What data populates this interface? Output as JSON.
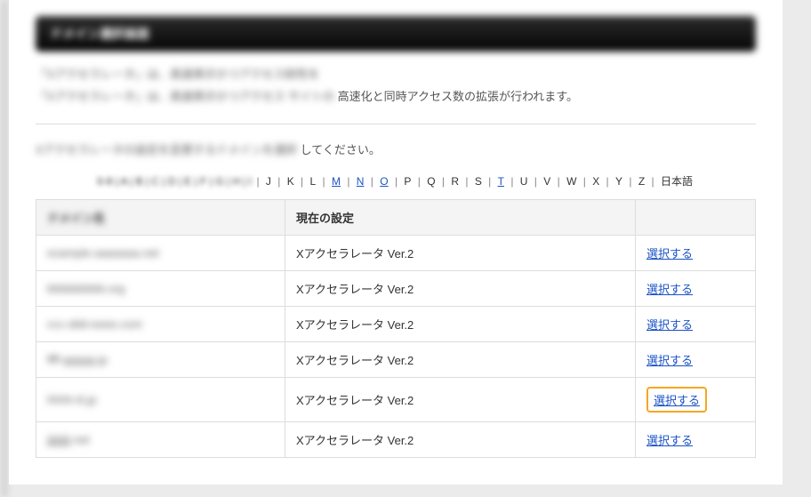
{
  "title_bar": "ドメイン選択画面",
  "desc_blur1": "「Xアクセラレータ」は、高速表示かつアクセス耐性を",
  "desc_blur2": "「Xアクセラレータ」は、高速表示かつアクセス  サイトの",
  "desc_clear": "高速化と同時アクセス数の拡張が行われます。",
  "instruction_blur": "Xアクセラレータの設定を変更するドメインを選択",
  "instruction_clear": "してください。",
  "alpha_blur_head": "0-9 | A | B | C | D | E | F | G | H | I",
  "alpha_items": [
    {
      "t": "J",
      "link": false
    },
    {
      "t": "K",
      "link": false
    },
    {
      "t": "L",
      "link": false
    },
    {
      "t": "M",
      "link": true
    },
    {
      "t": "N",
      "link": true
    },
    {
      "t": "O",
      "link": true
    },
    {
      "t": "P",
      "link": false
    },
    {
      "t": "Q",
      "link": false
    },
    {
      "t": "R",
      "link": false
    },
    {
      "t": "S",
      "link": false
    },
    {
      "t": "T",
      "link": true
    },
    {
      "t": "U",
      "link": false
    },
    {
      "t": "V",
      "link": false
    },
    {
      "t": "W",
      "link": false
    },
    {
      "t": "X",
      "link": false
    },
    {
      "t": "Y",
      "link": false
    },
    {
      "t": "Z",
      "link": false
    },
    {
      "t": "日本語",
      "link": false
    }
  ],
  "table": {
    "header_domain": "ドメイン名",
    "header_setting": "現在の設定",
    "header_action": "",
    "rows": [
      {
        "domain": "example-aaaaaaa.net",
        "setting": "Xアクセラレータ Ver.2",
        "action": "選択する",
        "hl": false
      },
      {
        "domain": "bbbbbbbbb.org",
        "setting": "Xアクセラレータ Ver.2",
        "action": "選択する",
        "hl": false
      },
      {
        "domain": "ccc-ddd-eeee.com",
        "setting": "Xアクセラレータ Ver.2",
        "action": "選択する",
        "hl": false
      },
      {
        "domain": "ffff-ggggg.jp",
        "setting": "Xアクセラレータ Ver.2",
        "action": "選択する",
        "hl": false
      },
      {
        "domain": "hhhh-iii.jp",
        "setting": "Xアクセラレータ Ver.2",
        "action": "選択する",
        "hl": true
      },
      {
        "domain": "jjjjjjjjj.net",
        "setting": "Xアクセラレータ Ver.2",
        "action": "選択する",
        "hl": false
      }
    ]
  }
}
